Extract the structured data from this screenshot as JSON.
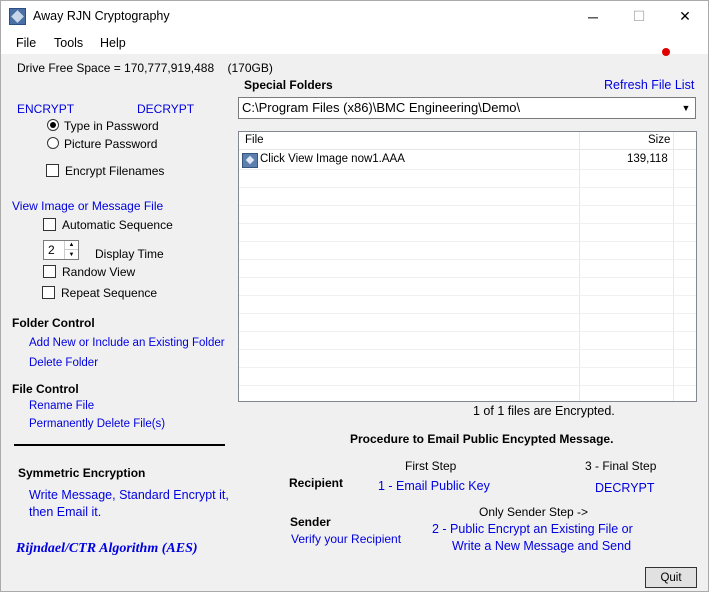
{
  "window": {
    "title": "Away RJN  Cryptography",
    "minimize_glyph": "─",
    "maximize_glyph": "☐",
    "close_glyph": "✕",
    "status_dot_color": "#e00000"
  },
  "menu": {
    "items": [
      "File",
      "Tools",
      "Help"
    ]
  },
  "drive": {
    "label": "Drive Free Space = 170,777,919,488    (170GB)"
  },
  "mode": {
    "encrypt_label": "ENCRYPT",
    "decrypt_label": "DECRYPT",
    "type_password_label": "Type in Password",
    "picture_password_label": "Picture Password",
    "encrypt_filenames_label": "Encrypt Filenames"
  },
  "view": {
    "heading": "View Image or Message File",
    "automatic_sequence_label": "Automatic Sequence",
    "display_time_value": "2",
    "display_time_label": "Display Time",
    "random_view_label": "Randow View",
    "repeat_sequence_label": "Repeat Sequence"
  },
  "folder_control": {
    "heading": "Folder Control",
    "add_folder_link": "Add New or Include an Existing Folder",
    "delete_folder_link": "Delete Folder"
  },
  "file_control": {
    "heading": "File Control",
    "rename_link": "Rename File",
    "delete_link": "Permanently Delete File(s)"
  },
  "symmetric": {
    "heading": "Symmetric Encryption",
    "line1": "Write Message, Standard Encrypt it,",
    "line2": "then Email it.",
    "algorithm": "Rijndael/CTR Algorithm (AES)"
  },
  "special_folders": {
    "heading": "Special Folders",
    "refresh_link": "Refresh File List",
    "selected_path": "C:\\Program Files (x86)\\BMC Engineering\\Demo\\"
  },
  "file_list": {
    "columns": [
      "File",
      "Size"
    ],
    "rows": [
      {
        "name": "Click View Image now1.AAA",
        "size": "139,118",
        "icon": "image-file-icon"
      }
    ],
    "status": "1 of 1 files are Encrypted."
  },
  "procedure": {
    "heading": "Procedure to Email Public Encypted Message.",
    "first_step_label": "First Step",
    "final_step_label": "3 - Final Step",
    "recipient_label": "Recipient",
    "email_public_key_link": "1 - Email Public Key",
    "decrypt_link": "DECRYPT",
    "sender_label": "Sender",
    "verify_recipient_link": "Verify your Recipient",
    "only_sender_step_label": "Only Sender Step ->",
    "public_encrypt_line1": "2 - Public Encrypt an Existing File or",
    "public_encrypt_line2": "Write a New Message and Send"
  },
  "buttons": {
    "quit_label": "Quit"
  }
}
